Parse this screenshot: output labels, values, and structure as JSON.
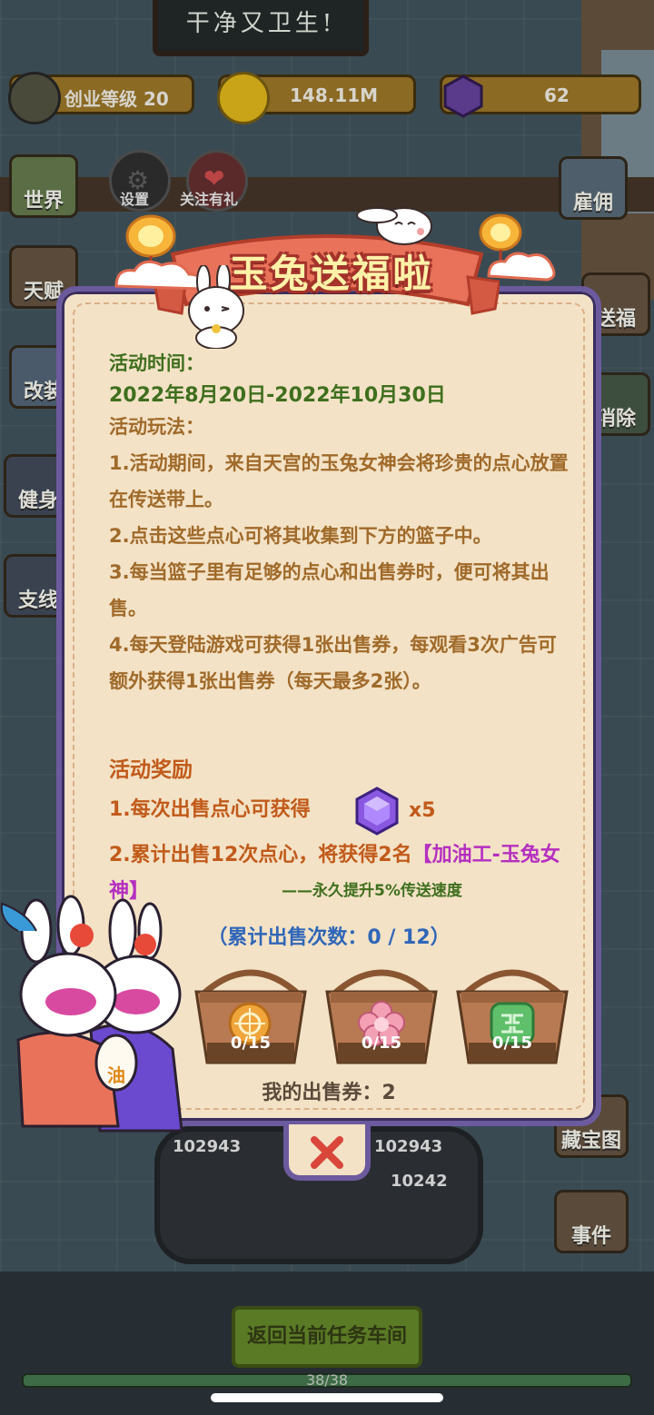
{
  "hud": {
    "level_label": "创业等级 20",
    "coins": "148.11M",
    "gems": "62"
  },
  "buttons": {
    "world": "世界",
    "settings": "设置",
    "follow": "关注有礼",
    "hire": "雇佣",
    "left_2": "天赋",
    "left_3": "改装",
    "left_4": "健身",
    "left_5": "支线",
    "right_2": "送福",
    "right_3": "消除",
    "treasure_map": "藏宝图",
    "events": "事件",
    "return": "返回当前任务车间"
  },
  "background": {
    "chalkboard": "干净又卫生!",
    "conveyor_numbers": [
      "102943",
      "102943",
      "10242"
    ]
  },
  "progress": {
    "label": "38/38",
    "fraction": 1.0
  },
  "modal": {
    "title": "玉兔送福啦",
    "time_label": "活动时间：",
    "time_value": "2022年8月20日-2022年10月30日",
    "rules_label": "活动玩法：",
    "rules": [
      "1.活动期间，来自天宫的玉兔女神会将珍贵的点心放置在传送带上。",
      "2.点击这些点心可将其收集到下方的篮子中。",
      "3.每当篮子里有足够的点心和出售券时，便可将其出售。",
      "4.每天登陆游戏可获得1张出售券，每观看3次广告可额外获得1张出售券（每天最多2张）。"
    ],
    "reward_label": "活动奖励",
    "reward_1_text": "1.每次出售点心可获得",
    "reward_1_amount": "x5",
    "reward_2_prefix": "2.累计出售12次点心，将获得2名",
    "reward_2_name": "【加油工-玉兔女神】",
    "reward_2_note": "——永久提升5%传送速度",
    "sold_count": "（累计出售次数：0 / 12）",
    "baskets": [
      {
        "icon": "mooncake-icon",
        "count": "0/15"
      },
      {
        "icon": "flower-cake-icon",
        "count": "0/15"
      },
      {
        "icon": "jade-cake-icon",
        "count": "0/15"
      }
    ],
    "tickets": "我的出售券：2",
    "bottle_label": "油"
  },
  "colors": {
    "panel_bg": "#f3e2c6",
    "panel_border": "#6c5a9e",
    "banner": "#e8735a",
    "title_text": "#fff2a8",
    "green": "#3f6f1e",
    "orange": "#c15a1a",
    "purple": "#b52fc0",
    "blue": "#2f66b8"
  }
}
